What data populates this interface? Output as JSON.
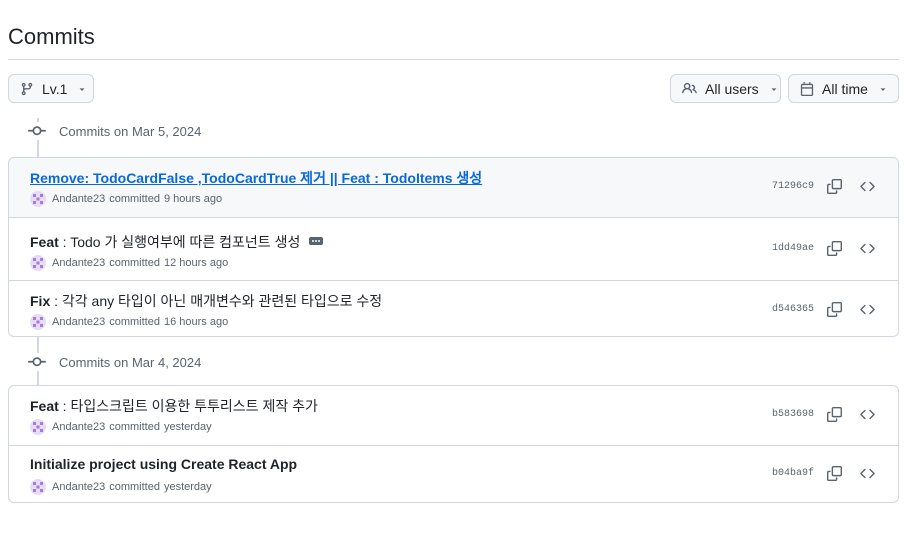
{
  "page": {
    "title": "Commits"
  },
  "toolbar": {
    "branch_label": "Lv.1",
    "users_label": "All users",
    "time_label": "All time"
  },
  "groups": [
    {
      "date_label": "Commits on Mar 5, 2024",
      "commits": [
        {
          "prefix": "",
          "text": "Remove: TodoCardFalse ,TodoCardTrue 제거 || Feat : TodoItems 생성",
          "author": "Andante23",
          "action": "committed",
          "time": "9 hours ago",
          "sha": "71296c9"
        },
        {
          "prefix": "Feat",
          "text": " : Todo 가 실행여부에 따른 컴포넌트 생성",
          "author": "Andante23",
          "action": "committed",
          "time": "12 hours ago",
          "sha": "1dd49ae"
        },
        {
          "prefix": "Fix",
          "text": " : 각각 any 타입이 아닌 매개변수와 관련된 타입으로 수정",
          "author": "Andante23",
          "action": "committed",
          "time": "16 hours ago",
          "sha": "d546365"
        }
      ]
    },
    {
      "date_label": "Commits on Mar 4, 2024",
      "commits": [
        {
          "prefix": "Feat",
          "text": " : 타입스크립트 이용한 투투리스트 제작 추가",
          "author": "Andante23",
          "action": "committed",
          "time": "yesterday",
          "sha": "b583698"
        },
        {
          "prefix": "",
          "text": "Initialize project using Create React App",
          "author": "Andante23",
          "action": "committed",
          "time": "yesterday",
          "sha": "b04ba9f"
        }
      ]
    }
  ],
  "icons": {
    "branch": "git-branch-icon",
    "users": "people-icon",
    "calendar": "calendar-icon",
    "commit": "git-commit-icon",
    "copy": "copy-icon",
    "code": "code-icon",
    "caret": "triangle-down-icon",
    "more": "ellipsis-icon"
  },
  "colors": {
    "link": "#0969da",
    "muted": "#59636e",
    "border": "#d0d7de",
    "highlight_bg": "#f6f8fa"
  }
}
